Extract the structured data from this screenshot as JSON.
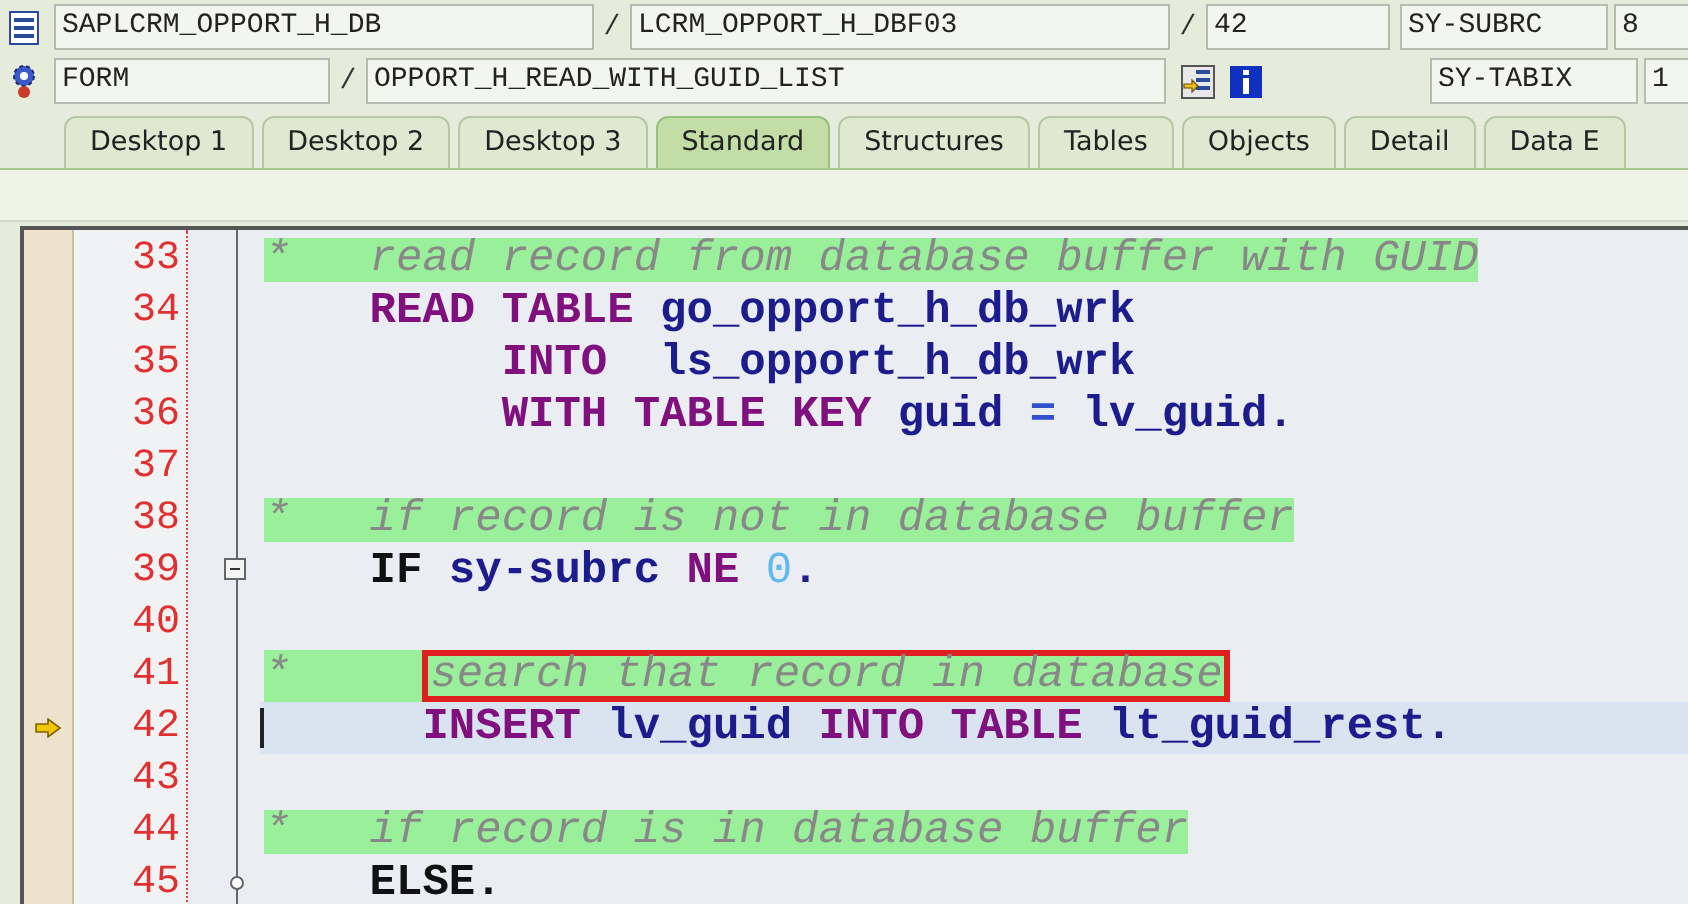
{
  "header": {
    "program": "SAPLCRM_OPPORT_H_DB",
    "include": "LCRM_OPPORT_H_DBF03",
    "line": "42",
    "block_type": "FORM",
    "block_name": "OPPORT_H_READ_WITH_GUID_LIST",
    "separators": [
      "/",
      "/",
      "/"
    ],
    "variables": [
      {
        "name": "SY-SUBRC",
        "value": "8"
      },
      {
        "name": "SY-TABIX",
        "value": "1"
      }
    ]
  },
  "tabs": [
    {
      "label": "Desktop 1",
      "selected": false
    },
    {
      "label": "Desktop 2",
      "selected": false
    },
    {
      "label": "Desktop 3",
      "selected": false
    },
    {
      "label": "Standard",
      "selected": true
    },
    {
      "label": "Structures",
      "selected": false
    },
    {
      "label": "Tables",
      "selected": false
    },
    {
      "label": "Objects",
      "selected": false
    },
    {
      "label": "Detail",
      "selected": false
    },
    {
      "label": "Data E",
      "selected": false
    }
  ],
  "code": [
    {
      "number": "33",
      "current": false,
      "tokens": [
        {
          "kind": "comment",
          "text": "*   read record from database buffer with GUID",
          "boxed": false
        }
      ]
    },
    {
      "number": "34",
      "current": false,
      "tokens": [
        {
          "kind": "keyword",
          "text": "    READ TABLE",
          "boxed": false
        },
        {
          "kind": "ident",
          "text": " go_opport_h_db_wrk",
          "boxed": false
        }
      ]
    },
    {
      "number": "35",
      "current": false,
      "tokens": [
        {
          "kind": "keyword",
          "text": "         INTO",
          "boxed": false
        },
        {
          "kind": "ident",
          "text": "  ls_opport_h_db_wrk",
          "boxed": false
        }
      ]
    },
    {
      "number": "36",
      "current": false,
      "tokens": [
        {
          "kind": "keyword",
          "text": "         WITH TABLE KEY",
          "boxed": false
        },
        {
          "kind": "ident",
          "text": " guid",
          "boxed": false
        },
        {
          "kind": "operator",
          "text": " =",
          "boxed": false
        },
        {
          "kind": "ident",
          "text": " lv_guid.",
          "boxed": false
        }
      ]
    },
    {
      "number": "37",
      "current": false
    },
    {
      "number": "38",
      "current": false,
      "tokens": [
        {
          "kind": "comment",
          "text": "*   if record is not in database buffer",
          "boxed": false
        }
      ]
    },
    {
      "number": "39",
      "current": false,
      "foldable": true,
      "tokens": [
        {
          "kind": "plain",
          "text": "    IF",
          "boxed": false
        },
        {
          "kind": "ident",
          "text": " sy-subrc",
          "boxed": false
        },
        {
          "kind": "keyword",
          "text": " NE",
          "boxed": false
        },
        {
          "kind": "number",
          "text": " 0",
          "boxed": false
        },
        {
          "kind": "ident",
          "text": ".",
          "boxed": false
        }
      ]
    },
    {
      "number": "40",
      "current": false
    },
    {
      "number": "41",
      "current": false,
      "tokens": [
        {
          "kind": "comment",
          "text": "*     ",
          "boxed": false
        },
        {
          "kind": "comment",
          "text": "search that record in database",
          "boxed": true
        }
      ]
    },
    {
      "number": "42",
      "current": true,
      "tokens": [
        {
          "kind": "keyword",
          "text": "      INSERT",
          "boxed": false
        },
        {
          "kind": "ident",
          "text": " lv_guid",
          "boxed": false
        },
        {
          "kind": "keyword",
          "text": " INTO TABLE",
          "boxed": false
        },
        {
          "kind": "ident",
          "text": " lt_guid_rest.",
          "boxed": false
        }
      ]
    },
    {
      "number": "43",
      "current": false
    },
    {
      "number": "44",
      "current": false,
      "tokens": [
        {
          "kind": "comment",
          "text": "*   if record is in database buffer",
          "boxed": false
        }
      ]
    },
    {
      "number": "45",
      "current": false,
      "branch": true,
      "tokens": [
        {
          "kind": "plain",
          "text": "    ELSE.",
          "boxed": false
        }
      ]
    }
  ]
}
